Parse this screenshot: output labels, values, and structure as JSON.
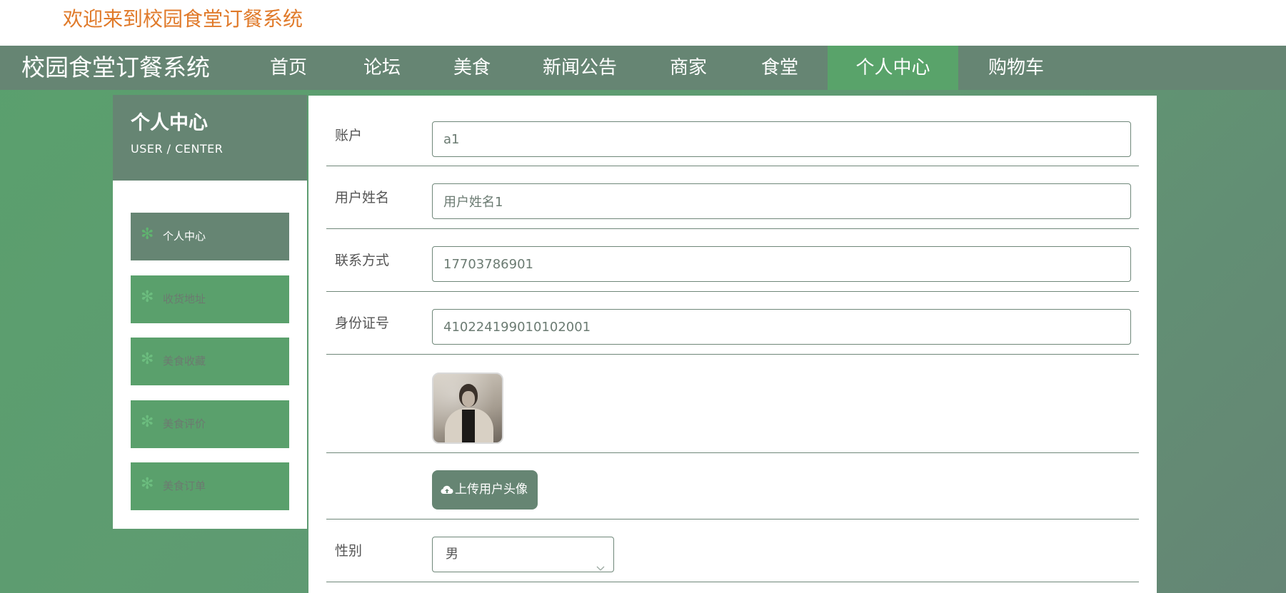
{
  "header": {
    "welcome": "欢迎来到校园食堂订餐系统"
  },
  "navbar": {
    "brand": "校园食堂订餐系统",
    "items": [
      {
        "label": "首页"
      },
      {
        "label": "论坛"
      },
      {
        "label": "美食"
      },
      {
        "label": "新闻公告"
      },
      {
        "label": "商家"
      },
      {
        "label": "食堂"
      },
      {
        "label": "个人中心",
        "active": true
      },
      {
        "label": "购物车"
      }
    ]
  },
  "sidebar": {
    "title": "个人中心",
    "subtitle": "USER / CENTER",
    "items": [
      {
        "label": "个人中心",
        "active": true,
        "icon": "asterisk-icon"
      },
      {
        "label": "收货地址",
        "icon": "asterisk-icon"
      },
      {
        "label": "美食收藏",
        "icon": "asterisk-icon"
      },
      {
        "label": "美食评价",
        "icon": "asterisk-icon"
      },
      {
        "label": "美食订单",
        "icon": "asterisk-icon"
      }
    ]
  },
  "form": {
    "account": {
      "label": "账户",
      "value": "a1"
    },
    "name": {
      "label": "用户姓名",
      "value": "用户姓名1"
    },
    "phone": {
      "label": "联系方式",
      "value": "17703786901"
    },
    "id_number": {
      "label": "身份证号",
      "value": "410224199010102001"
    },
    "avatar": {
      "icon": "user-avatar"
    },
    "upload": {
      "label": "上传用户头像",
      "icon": "cloud-upload-icon"
    },
    "gender": {
      "label": "性别",
      "value": "男"
    }
  },
  "colors": {
    "accent": "#59a36a",
    "nav_bg": "#668573",
    "welcome": "#e07a2a"
  }
}
